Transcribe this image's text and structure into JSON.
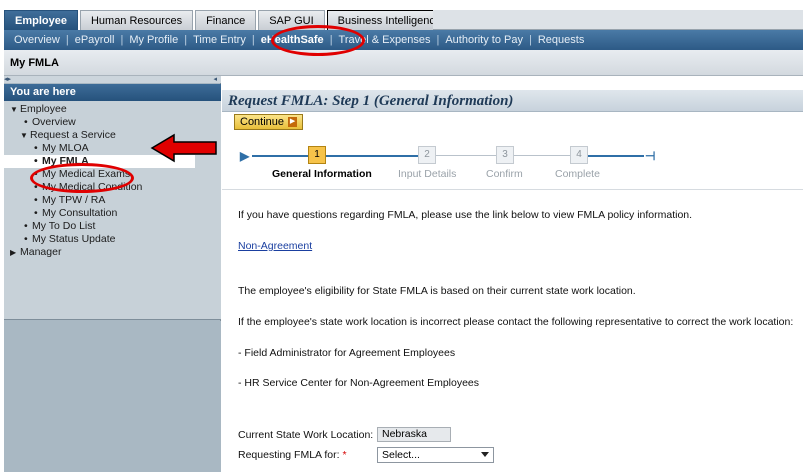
{
  "top_tabs": [
    {
      "label": "Employee",
      "active": true
    },
    {
      "label": "Human Resources",
      "active": false
    },
    {
      "label": "Finance",
      "active": false
    },
    {
      "label": "SAP GUI",
      "active": false
    },
    {
      "label": "Business Intelligence",
      "active": false
    }
  ],
  "sub_nav": [
    {
      "label": "Overview",
      "active": false
    },
    {
      "label": "ePayroll",
      "active": false
    },
    {
      "label": "My Profile",
      "active": false
    },
    {
      "label": "Time Entry",
      "active": false
    },
    {
      "label": "eHealthSafe",
      "active": true
    },
    {
      "label": "Travel & Expenses",
      "active": false
    },
    {
      "label": "Authority to Pay",
      "active": false
    },
    {
      "label": "Requests",
      "active": false
    }
  ],
  "sub_nav_separator": "|",
  "page_title": "My FMLA",
  "left_panel": {
    "heading": "You are here",
    "tree": [
      {
        "label": "Employee",
        "icon": "triangle-down-icon",
        "bullet": ""
      },
      {
        "label": "Overview",
        "bullet": "•"
      },
      {
        "label": "Request a Service",
        "icon": "triangle-down-icon",
        "bullet": ""
      },
      {
        "label": "My MLOA",
        "bullet": "•"
      },
      {
        "label": "My FMLA",
        "bullet": "•",
        "selected": true
      },
      {
        "label": "My Medical Exams",
        "bullet": "•"
      },
      {
        "label": "My Medical Condition",
        "bullet": "•"
      },
      {
        "label": "My TPW / RA",
        "bullet": "•"
      },
      {
        "label": "My Consultation",
        "bullet": "•"
      },
      {
        "label": "My To Do List",
        "bullet": "•"
      },
      {
        "label": "My Status Update",
        "bullet": "•"
      },
      {
        "label": "Manager",
        "icon": "triangle-right-icon",
        "bullet": ""
      }
    ]
  },
  "main": {
    "title": "Request FMLA: Step 1 (General Information)",
    "continue_label": "Continue",
    "roadmap": [
      {
        "num": "1",
        "label": "General Information",
        "active": true
      },
      {
        "num": "2",
        "label": "Input Details",
        "active": false
      },
      {
        "num": "3",
        "label": "Confirm",
        "active": false
      },
      {
        "num": "4",
        "label": "Complete",
        "active": false
      }
    ],
    "para1": "If you have questions regarding FMLA, please use the link below to view FMLA policy information.",
    "link_label": "Non-Agreement",
    "para2": "The employee's eligibility for State FMLA is based on their current state work location.",
    "para3": "If the employee's state work location is incorrect please contact the following representative to correct the work location:",
    "bullet1": "- Field Administrator for Agreement Employees",
    "bullet2": "- HR Service Center for Non-Agreement Employees",
    "work_location_label": "Current State Work Location:",
    "work_location_value": "Nebraska",
    "requesting_label": "Requesting FMLA for:",
    "required_marker": "*",
    "select_value": "Select..."
  },
  "colors": {
    "annotation_red": "#e00000",
    "nav_blue": "#2d5a86",
    "step_active": "#f6c34a"
  }
}
